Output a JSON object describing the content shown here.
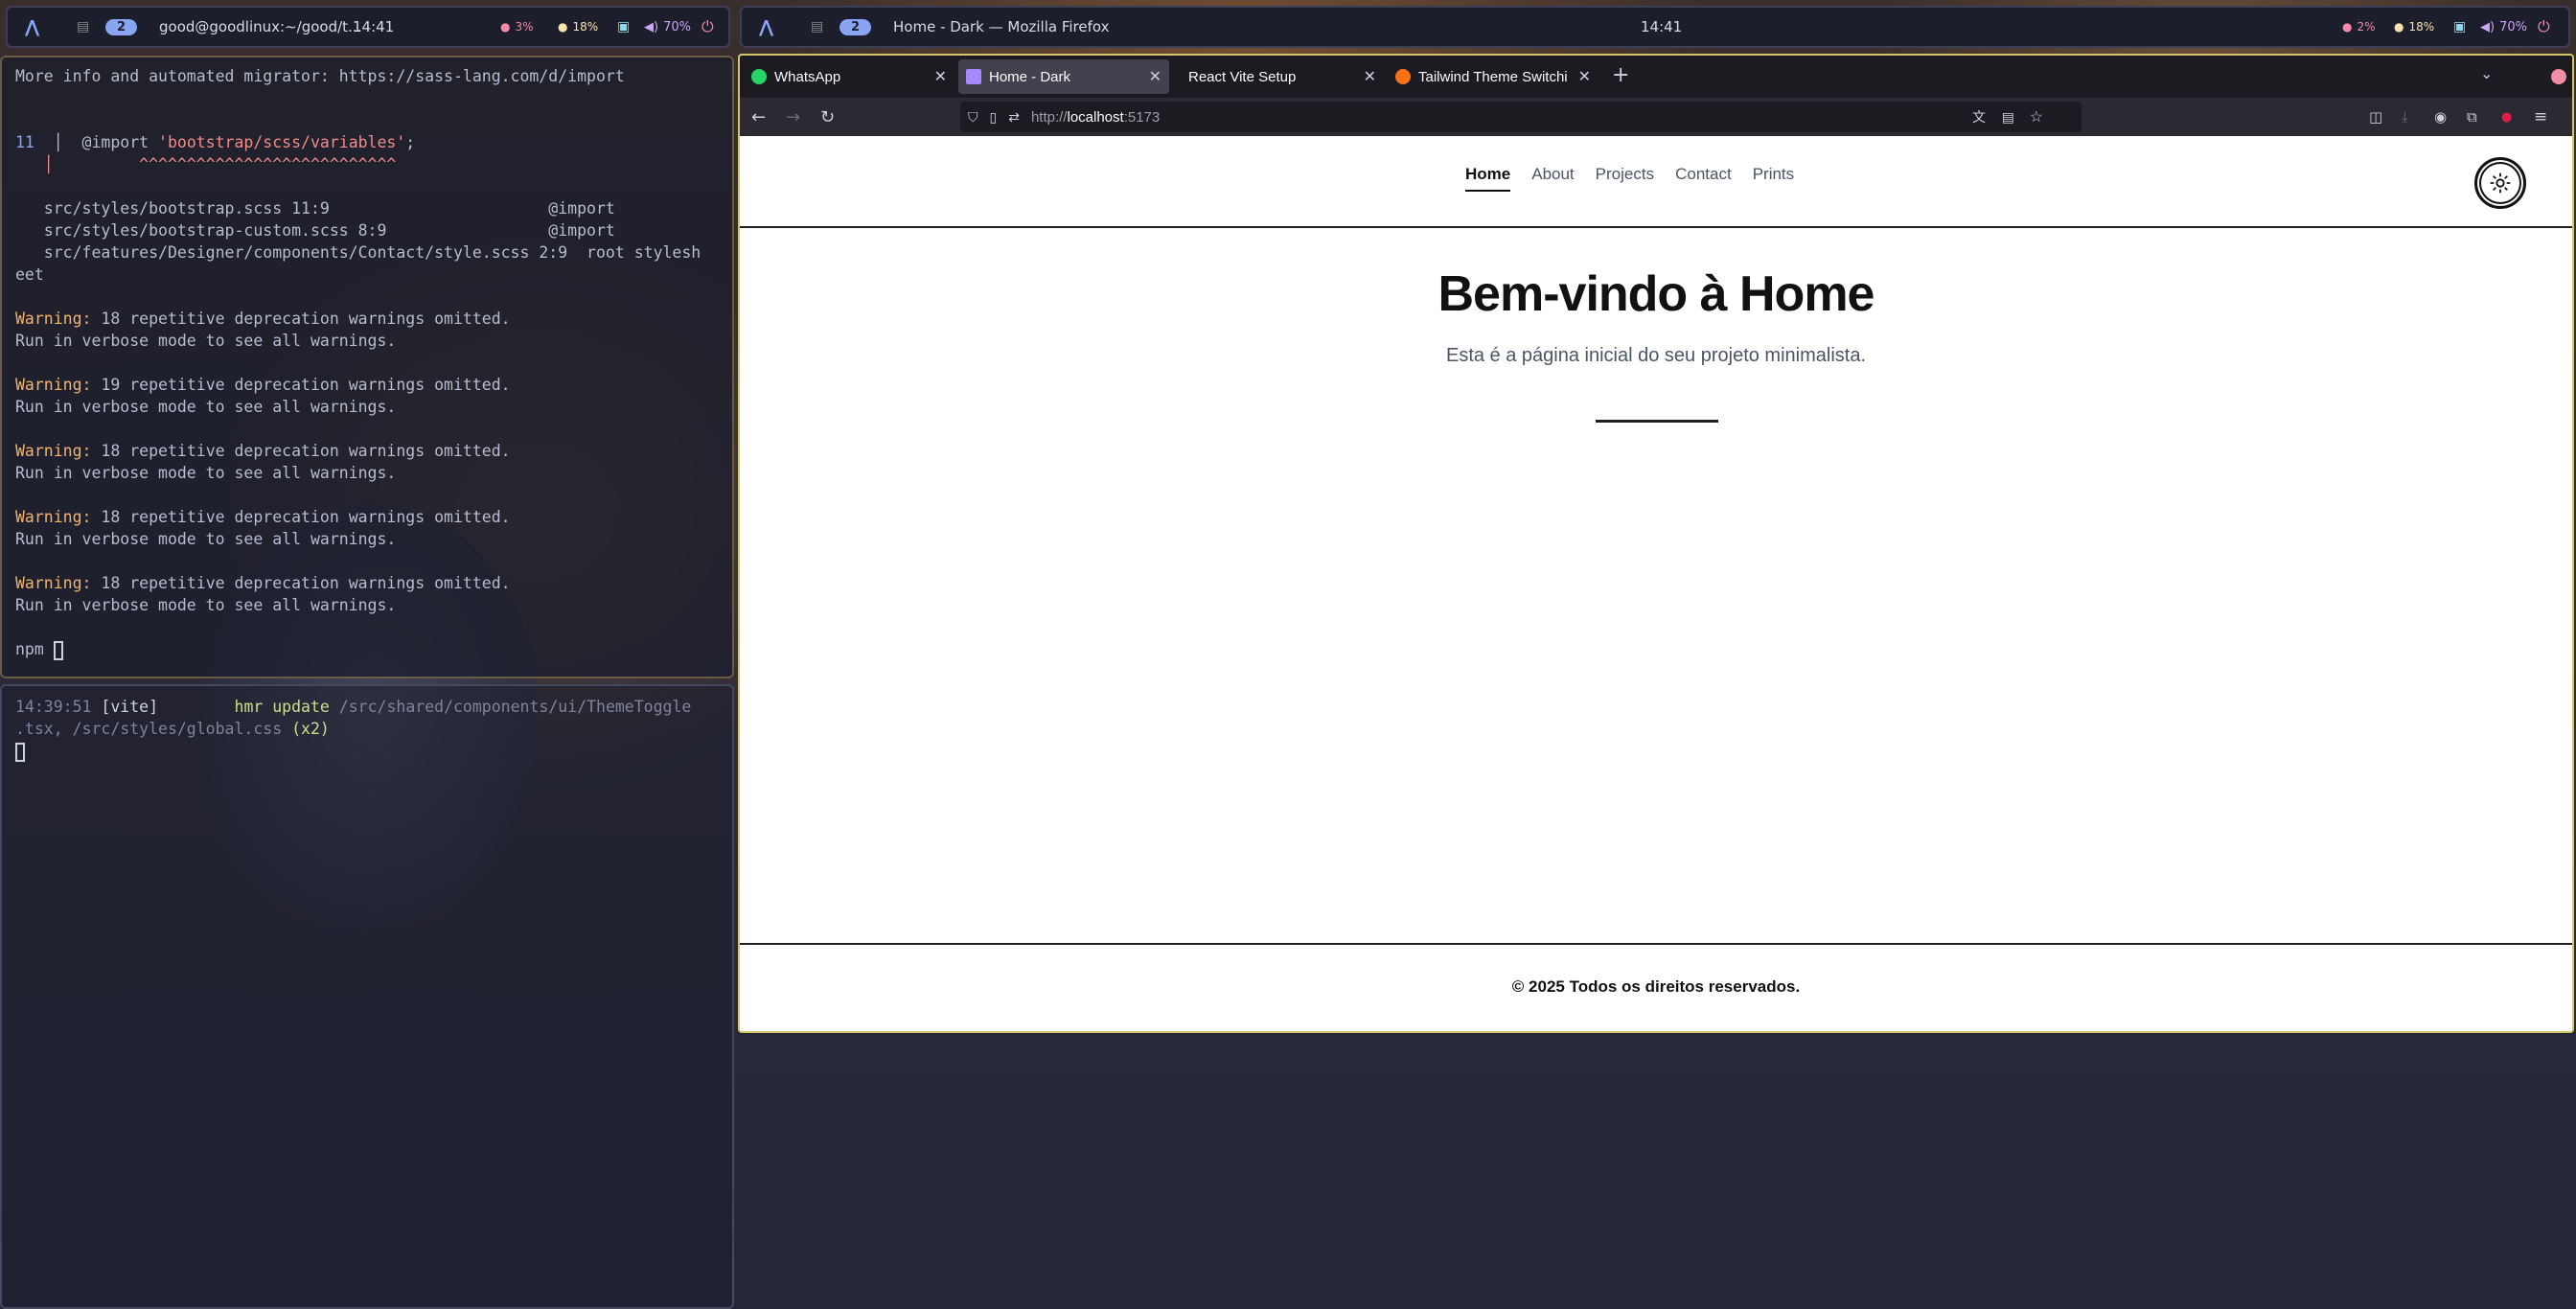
{
  "left_bar": {
    "logo": "⋀",
    "workspace_inactive": "▤",
    "workspace_active": "2",
    "title": "good@goodlinux:~/good/t...",
    "clock": "14:41",
    "cpu": "3%",
    "mem": "18%",
    "volume": "70%"
  },
  "right_bar": {
    "logo": "⋀",
    "workspace_inactive": "▤",
    "workspace_active": "2",
    "title": "Home - Dark — Mozilla Firefox",
    "clock": "14:41",
    "cpu": "2%",
    "mem": "18%",
    "volume": "70%"
  },
  "terminal_top": {
    "lines": [
      {
        "text": "More info and automated migrator: https://sass-lang.com/d/import"
      },
      {
        "text": ""
      },
      {
        "text": ""
      },
      {
        "num": "11",
        "pre": "  │  @import ",
        "str": "'bootstrap/scss/variables'",
        "post": ";"
      },
      {
        "carets": "   │         ^^^^^^^^^^^^^^^^^^^^^^^^^^^"
      },
      {
        "text": ""
      },
      {
        "text": "   src/styles/bootstrap.scss 11:9                       @import"
      },
      {
        "text": "   src/styles/bootstrap-custom.scss 8:9                 @import"
      },
      {
        "text": "   src/features/Designer/components/Contact/style.scss 2:9  root stylesh"
      },
      {
        "text": "eet"
      },
      {
        "text": ""
      },
      {
        "warn": "Warning:",
        "text": " 18 repetitive deprecation warnings omitted."
      },
      {
        "text": "Run in verbose mode to see all warnings."
      },
      {
        "text": ""
      },
      {
        "warn": "Warning:",
        "text": " 19 repetitive deprecation warnings omitted."
      },
      {
        "text": "Run in verbose mode to see all warnings."
      },
      {
        "text": ""
      },
      {
        "warn": "Warning:",
        "text": " 18 repetitive deprecation warnings omitted."
      },
      {
        "text": "Run in verbose mode to see all warnings."
      },
      {
        "text": ""
      },
      {
        "warn": "Warning:",
        "text": " 18 repetitive deprecation warnings omitted."
      },
      {
        "text": "Run in verbose mode to see all warnings."
      },
      {
        "text": ""
      },
      {
        "warn": "Warning:",
        "text": " 18 repetitive deprecation warnings omitted."
      },
      {
        "text": "Run in verbose mode to see all warnings."
      },
      {
        "text": ""
      },
      {
        "prompt": "npm"
      }
    ]
  },
  "terminal_bottom": {
    "time": "14:39:51",
    "tag": "[vite]",
    "hmr": "hmr update",
    "path1": "/src/shared/components/ui/ThemeToggle",
    "path2": ".tsx, /src/styles/global.css",
    "count": "(x2)"
  },
  "browser": {
    "tabs": [
      {
        "label": "WhatsApp",
        "favicon_color": "#25d366",
        "active": false
      },
      {
        "label": "Home - Dark",
        "favicon_color": "#a78bfa",
        "active": true
      },
      {
        "label": "React Vite Setup",
        "favicon_color": "",
        "active": false
      },
      {
        "label": "Tailwind Theme Switchi",
        "favicon_color": "#f97316",
        "active": false
      }
    ],
    "new_tab": "+",
    "url_proto": "http://",
    "url_host": "localhost",
    "url_port": ":5173"
  },
  "site": {
    "nav": [
      "Home",
      "About",
      "Projects",
      "Contact",
      "Prints"
    ],
    "title": "Bem-vindo à Home",
    "subtitle": "Esta é a página inicial do seu projeto minimalista.",
    "footer": "© 2025 Todos os direitos reservados."
  },
  "colors": {
    "accent_warning": "#f4b26a",
    "workspace_active": "#89a4f0",
    "firefox_border": "#d4c46a"
  }
}
